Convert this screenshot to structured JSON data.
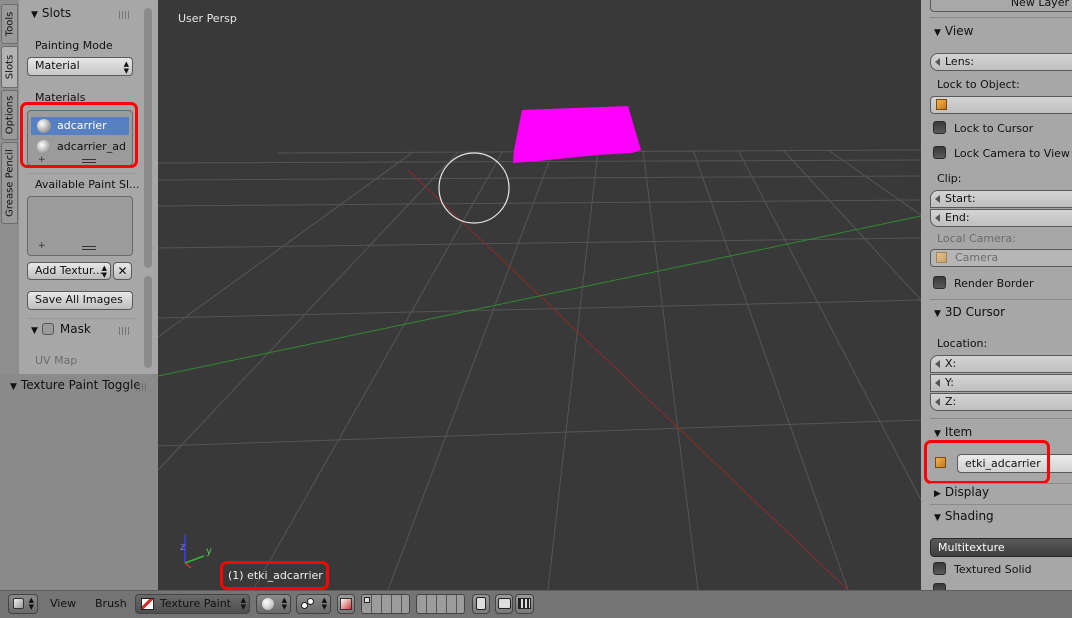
{
  "shelf": {
    "tabs": [
      "Tools",
      "Slots",
      "Options",
      "Grease Pencil"
    ],
    "active_tab": "Slots",
    "slots_header": "Slots",
    "painting_mode_label": "Painting Mode",
    "painting_mode_value": "Material",
    "materials_label": "Materials",
    "materials": [
      "adcarrier",
      "adcarrier_ad"
    ],
    "selected_material": "adcarrier",
    "available_slots_label": "Available Paint Sl...",
    "add_texture_label": "Add Textur...",
    "save_all_images_label": "Save All Images",
    "mask_header": "Mask",
    "uv_map_label": "UV Map"
  },
  "operator_panel": {
    "title": "Texture Paint Toggle"
  },
  "viewport": {
    "view_label": "User Persp",
    "object_label": "(1) etki_adcarrier",
    "axis_y": "y",
    "axis_z": "z",
    "mesh_color": "#ff00ff",
    "x_axis_color": "#8c2a2a",
    "y_axis_color": "#2f8a2f"
  },
  "props": {
    "new_layer_label": "New Layer",
    "view_header": "View",
    "lens_label": "Lens:",
    "lock_to_object_label": "Lock to Object:",
    "lock_to_cursor_label": "Lock to Cursor",
    "lock_camera_label": "Lock Camera to View",
    "clip_label": "Clip:",
    "clip_start_label": "Start:",
    "clip_end_label": "End:",
    "local_camera_label": "Local Camera:",
    "camera_label": "Camera",
    "render_border_label": "Render Border",
    "cursor_header": "3D Cursor",
    "location_label": "Location:",
    "loc_x": "X:",
    "loc_y": "Y:",
    "loc_z": "Z:",
    "item_header": "Item",
    "item_name": "etki_adcarrier",
    "display_header": "Display",
    "shading_header": "Shading",
    "shading_mode": "Multitexture",
    "textured_solid_label": "Textured Solid"
  },
  "footer": {
    "view_menu": "View",
    "brush_menu": "Brush",
    "mode_label": "Texture Paint"
  },
  "highlight_color": "#ff0000"
}
